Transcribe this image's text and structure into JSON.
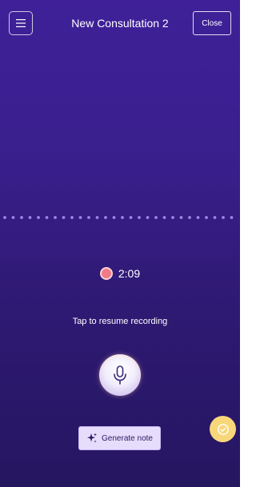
{
  "header": {
    "menu_icon": "hamburger-menu-icon",
    "title": "New Consultation 2",
    "close_label": "Close"
  },
  "recording": {
    "status_icon": "record-dot-icon",
    "elapsed": "2:09",
    "hint": "Tap to resume recording",
    "mic_icon": "microphone-icon"
  },
  "actions": {
    "generate_icon": "sparkle-icon",
    "generate_label": "Generate note"
  },
  "fab": {
    "icon": "check-circle-icon"
  },
  "colors": {
    "background_top": "#3f2098",
    "background_bottom": "#251660",
    "record_dot": "#f07a86",
    "button_fill": "#e6dcfb",
    "fab_fill": "#f7d77a",
    "waveform_dot": "#9e86e0"
  }
}
